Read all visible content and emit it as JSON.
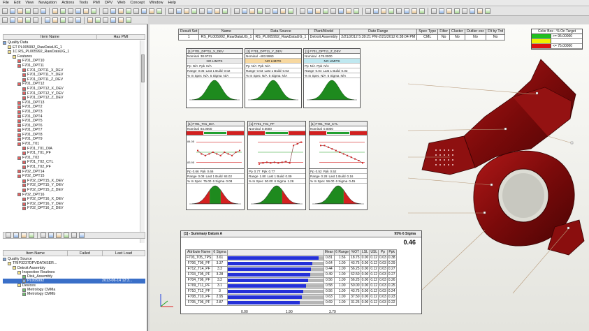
{
  "menu": [
    "File",
    "Edit",
    "View",
    "Navigation",
    "Actions",
    "Tools",
    "PMI",
    "DPV",
    "Web",
    "Concept",
    "Window",
    "Help"
  ],
  "tree1": {
    "col_item": "Item Name",
    "col_pmi": "Has PMI",
    "rows": [
      {
        "indent": 0,
        "icon": "blue",
        "label": "Quality Data"
      },
      {
        "indent": 1,
        "icon": "yellow",
        "label": "ET PL005992_RawDataUG_1"
      },
      {
        "indent": 1,
        "icon": "yellow",
        "label": "1C RS_PL005992_RawDataUG_1"
      },
      {
        "indent": 2,
        "icon": "yellow",
        "label": "Features"
      },
      {
        "indent": 3,
        "icon": "red",
        "label": "F701_DPT10"
      },
      {
        "indent": 3,
        "icon": "red",
        "label": "F701_DPT11"
      },
      {
        "indent": 4,
        "icon": "red",
        "label": "F701_DPT11_X_DEV"
      },
      {
        "indent": 4,
        "icon": "red",
        "label": "F701_DPT11_Y_DEV"
      },
      {
        "indent": 4,
        "icon": "red",
        "label": "F701_DPT11_Z_DEV"
      },
      {
        "indent": 3,
        "icon": "red",
        "label": "F701_DPT12"
      },
      {
        "indent": 4,
        "icon": "red",
        "label": "F701_DPT12_X_DEV"
      },
      {
        "indent": 4,
        "icon": "red",
        "label": "F701_DPT12_Y_DEV"
      },
      {
        "indent": 4,
        "icon": "red",
        "label": "F701_DPT12_Z_DEV"
      },
      {
        "indent": 3,
        "icon": "red",
        "label": "F701_DPT13"
      },
      {
        "indent": 3,
        "icon": "red",
        "label": "F701_DPT2"
      },
      {
        "indent": 3,
        "icon": "red",
        "label": "F701_DPT3"
      },
      {
        "indent": 3,
        "icon": "red",
        "label": "F701_DPT4"
      },
      {
        "indent": 3,
        "icon": "red",
        "label": "F701_DPT5"
      },
      {
        "indent": 3,
        "icon": "red",
        "label": "F701_DPT6"
      },
      {
        "indent": 3,
        "icon": "red",
        "label": "F701_DPT7"
      },
      {
        "indent": 3,
        "icon": "red",
        "label": "F701_DPT8"
      },
      {
        "indent": 3,
        "icon": "red",
        "label": "F701_DPT9"
      },
      {
        "indent": 3,
        "icon": "red",
        "label": "F701_T01"
      },
      {
        "indent": 4,
        "icon": "red",
        "label": "F701_T01_DIA"
      },
      {
        "indent": 4,
        "icon": "red",
        "label": "F701_T01_PF"
      },
      {
        "indent": 3,
        "icon": "red",
        "label": "F701_T02"
      },
      {
        "indent": 4,
        "icon": "red",
        "label": "F701_T02_CYL"
      },
      {
        "indent": 4,
        "icon": "red",
        "label": "F701_T02_PF"
      },
      {
        "indent": 3,
        "icon": "red",
        "label": "F702_DPT14"
      },
      {
        "indent": 3,
        "icon": "red",
        "label": "F702_DPT15"
      },
      {
        "indent": 4,
        "icon": "red",
        "label": "F702_DPT15_X_DEV"
      },
      {
        "indent": 4,
        "icon": "red",
        "label": "F702_DPT15_Y_DEV"
      },
      {
        "indent": 4,
        "icon": "red",
        "label": "F702_DPT15_Z_DEV"
      },
      {
        "indent": 3,
        "icon": "red",
        "label": "F702_DPT16"
      },
      {
        "indent": 4,
        "icon": "red",
        "label": "F702_DPT16_X_DEV"
      },
      {
        "indent": 4,
        "icon": "red",
        "label": "F702_DPT16_Y_DEV"
      },
      {
        "indent": 4,
        "icon": "red",
        "label": "F702_DPT16_Z_DEV"
      }
    ]
  },
  "tree2": {
    "col_item": "Item Name",
    "col_failed": "Failed",
    "col_last": "Last Load",
    "rows": [
      {
        "indent": 0,
        "icon": "blue",
        "label": "Quality Source",
        "extra": ""
      },
      {
        "indent": 1,
        "icon": "yellow",
        "label": "TRIP3237DPVDATASER...",
        "extra": ""
      },
      {
        "indent": 2,
        "icon": "yellow",
        "label": "Detroit Assembly",
        "extra": ""
      },
      {
        "indent": 3,
        "icon": "yellow",
        "label": "Inspection Routines",
        "extra": ""
      },
      {
        "indent": 4,
        "icon": "green",
        "label": "Disk_Assembly",
        "extra": ""
      },
      {
        "indent": 4,
        "icon": "blue",
        "label": "PL005992",
        "extra": "2013-06-14 12:3...",
        "selected": true
      },
      {
        "indent": 3,
        "icon": "yellow",
        "label": "Devices",
        "extra": ""
      },
      {
        "indent": 4,
        "icon": "green",
        "label": "Metrology CMMa",
        "extra": ""
      },
      {
        "indent": 4,
        "icon": "green",
        "label": "Metrology CMMb",
        "extra": ""
      }
    ]
  },
  "results": {
    "headers": [
      "Result Set",
      "Name",
      "Data Source",
      "Plant/Model",
      "Date Range",
      "Spec Type",
      "Filter",
      "Cluster",
      "Outlier exc",
      "Flt by Trd"
    ],
    "row": [
      "1",
      "RS_PL005992_RawDataUG_1",
      "RS_PL005992_RawDataUG_1",
      "Detroit Assembly",
      "2/21/2012 5:39:21 PM-2/21/2012 6:38:04 PM",
      "CML",
      "No",
      "No",
      "No",
      "No"
    ]
  },
  "color_box": {
    "title": "Color Box - % On Target",
    "rows": [
      {
        "color": "#20c020",
        "label": ">= 95.00000"
      },
      {
        "color": "#f0f000",
        "label": ""
      },
      {
        "color": "#e01010",
        "label": "<= 75.00000"
      }
    ]
  },
  "dist_top": [
    {
      "title": "[1] F701_DPT11_X_DEV",
      "nominal_label": "Nominal",
      "nominal": "38.9731",
      "limits": "NO LIMITS",
      "pp": "N/A",
      "ppk": "N/A",
      "range": "0.05",
      "last": "0.02",
      "spec": "N/A",
      "sigma": "N/A"
    },
    {
      "title": "[1] F701_DPT11_Y_DEV",
      "nominal_label": "Nominal",
      "nominal": "-483.5960",
      "limits": "NO LIMITS",
      "pp": "N/A",
      "ppk": "N/A",
      "range": "0.03",
      "last": "0.03",
      "spec": "N/A",
      "sigma": "N/A"
    },
    {
      "title": "[1] F701_DPT11_Z_DEV",
      "nominal_label": "Nominal",
      "nominal": "-178.0000",
      "limits": "NO LIMITS",
      "pp": "N/A",
      "ppk": "N/A",
      "range": "0.04",
      "last": "0.03",
      "spec": "N/A",
      "sigma": "N/A"
    }
  ],
  "dist_labels": {
    "pp": "Pp",
    "ppk": "Ppk",
    "range": "Range",
    "last": "Last 1 Build",
    "spec": "% In Spec",
    "sigma": "6 Sigma"
  },
  "dist_bottom": [
    {
      "title": "[1] F701_T01_DIA",
      "nominal_label": "Nominal",
      "nominal": "84.0000",
      "pp": "0.66",
      "ppk": "0.66",
      "range": "0.08",
      "last": "84.02",
      "spec": "75.00",
      "sigma": "0.08",
      "y_max": "84.05",
      "y_min": "83.95"
    },
    {
      "title": "[1] F701_T01_PF",
      "nominal_label": "Nominal",
      "nominal": "0.0000",
      "pp": "0.77",
      "ppk": "0.77",
      "range": "1.80",
      "last": "0.09",
      "spec": "50.00",
      "sigma": "1.26",
      "y_max": "",
      "y_min": ""
    },
    {
      "title": "[1] F701_T02_CYL",
      "nominal_label": "Nominal",
      "nominal": "0.0000",
      "pp": "0.52",
      "ppk": "0.52",
      "range": "0.28",
      "last": "0.16",
      "spec": "56.00",
      "sigma": "0.45",
      "y_max": "",
      "y_min": ""
    }
  ],
  "summary": {
    "title": "[1] - Summary Datum A",
    "metric_label": "95% 6 Sigma",
    "metric_value": "0.46",
    "headers": [
      "Attribute Name",
      "6 Sigma",
      "",
      "Mean",
      "6 Range",
      "%OT",
      "LSL",
      "USL",
      "Pp",
      "Ppk"
    ],
    "rows": [
      {
        "name": "F703_T05_TPS",
        "sigma": 3.61,
        "mean": "0.81",
        "range": "1.56",
        "ot": "18.75",
        "lsl": "0.00",
        "usl": "0.12",
        "pp": "0.03",
        "ppk": "0.38"
      },
      {
        "name": "F706_T06_PF",
        "sigma": 3.37,
        "mean": "0.64",
        "range": "1.00",
        "ot": "43.75",
        "lsl": "0.00",
        "usl": "0.12",
        "pp": "0.03",
        "ppk": "0.29"
      },
      {
        "name": "F712_T14_PF",
        "sigma": 3.3,
        "mean": "0.44",
        "range": "1.00",
        "ot": "56.25",
        "lsl": "0.00",
        "usl": "0.12",
        "pp": "0.03",
        "ppk": "0.27"
      },
      {
        "name": "F703_T05_PF",
        "sigma": 3.28,
        "mean": "0.49",
        "range": "1.00",
        "ot": "62.50",
        "lsl": "0.00",
        "usl": "0.12",
        "pp": "0.03",
        "ppk": "0.27"
      },
      {
        "name": "F704_T06_PF",
        "sigma": 3.2,
        "mean": "0.56",
        "range": "1.00",
        "ot": "56.25",
        "lsl": "0.00",
        "usl": "0.12",
        "pp": "0.03",
        "ppk": "0.26"
      },
      {
        "name": "F709_T11_PF",
        "sigma": 3.1,
        "mean": "0.58",
        "range": "1.00",
        "ot": "50.00",
        "lsl": "0.00",
        "usl": "0.12",
        "pp": "0.03",
        "ppk": "0.25"
      },
      {
        "name": "F710_T12_PF",
        "sigma": 3.0,
        "mean": "0.56",
        "range": "1.00",
        "ot": "43.75",
        "lsl": "0.00",
        "usl": "0.12",
        "pp": "0.03",
        "ppk": "0.24"
      },
      {
        "name": "F708_T10_PF",
        "sigma": 2.95,
        "mean": "0.63",
        "range": "1.00",
        "ot": "37.50",
        "lsl": "0.00",
        "usl": "0.12",
        "pp": "0.03",
        "ppk": "0.23"
      },
      {
        "name": "F705_T06_PF",
        "sigma": 2.87,
        "mean": "0.69",
        "range": "1.00",
        "ot": "31.25",
        "lsl": "0.00",
        "usl": "0.12",
        "pp": "0.03",
        "ppk": "0.22"
      }
    ],
    "axis_min_label": "0.00",
    "axis_mid_label": "1.90",
    "axis_max_label": "3.79",
    "axis_max": 3.79
  }
}
